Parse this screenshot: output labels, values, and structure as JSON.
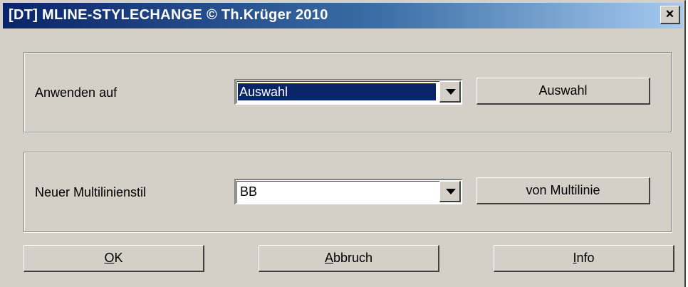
{
  "window": {
    "title": "[DT] MLINE-STYLECHANGE © Th.Krüger 2010",
    "close_label": "×"
  },
  "apply": {
    "label": "Anwenden auf",
    "selected": "Auswahl",
    "button": "Auswahl"
  },
  "style": {
    "label": "Neuer Multilinienstil",
    "selected": "BB",
    "button": "von Multilinie"
  },
  "footer": {
    "ok_mnemonic": "O",
    "ok_rest": "K",
    "cancel_mnemonic": "A",
    "cancel_rest": "bbruch",
    "info_mnemonic": "I",
    "info_rest": "nfo"
  },
  "colors": {
    "titlebar_start": "#0a246a",
    "titlebar_end": "#a6caf0",
    "face": "#d4d0c8"
  }
}
